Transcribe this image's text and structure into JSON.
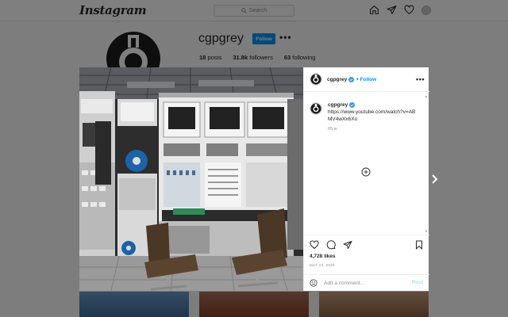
{
  "app": {
    "logo": "Instagram",
    "search_placeholder": "Search"
  },
  "profile": {
    "username": "cgpgrey",
    "follow_label": "Follow",
    "more": "•••",
    "stats": [
      {
        "count": "18",
        "label": "posts"
      },
      {
        "count": "31.8k",
        "label": "followers"
      },
      {
        "count": "63",
        "label": "following"
      }
    ]
  },
  "modal": {
    "header": {
      "username": "cgpgrey",
      "dot": "•",
      "follow_label": "Follow",
      "more": "•••"
    },
    "caption": {
      "username": "cgpgrey",
      "text": "https://www.youtube.com/watch?v=ABMV4wXx6Xo",
      "time": "65 w"
    },
    "likes": "4,728 likes",
    "date": "MAY 13, 2020",
    "comment_placeholder": "Add a comment...",
    "post_label": "Post",
    "next_arrow": "›"
  },
  "colors": {
    "accent": "#0095f6",
    "post_disabled": "#b2dffc",
    "overlay": "rgba(0,0,0,0.5)"
  },
  "icons": [
    "search-icon",
    "home-icon",
    "direct-icon",
    "activity-icon",
    "heart-icon",
    "comment-icon",
    "share-icon",
    "bookmark-icon",
    "emoji-icon",
    "plus-circle-icon",
    "verified-badge-icon",
    "chevron-right-icon"
  ]
}
